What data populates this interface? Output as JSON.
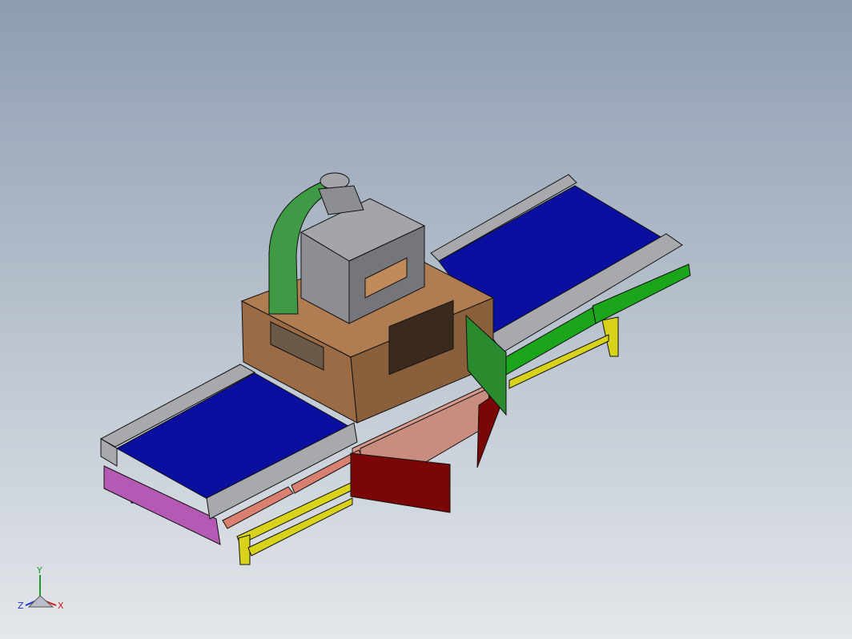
{
  "viewport": {
    "background_top": "#8d9db1",
    "background_bottom": "#e4e7eb"
  },
  "triad": {
    "x_label": "X",
    "y_label": "Y",
    "z_label": "Z",
    "x_color": "#d21c1c",
    "y_color": "#1f9a2a",
    "z_color": "#2233c8"
  },
  "colors": {
    "belt": "#0b0fa0",
    "rail": "#a7a9ad",
    "cabinet": "#9a6b45",
    "hood": "#8c8e93",
    "duct": "#3f9a45",
    "door_red": "#7a0606",
    "door_green": "#2a8a2e",
    "panel_green": "#1aa51a",
    "panel_salmon": "#d98070",
    "skirt_magenta": "#b45ab4",
    "frame_yellow": "#d8d31a",
    "lower_body": "#d69a8c"
  }
}
